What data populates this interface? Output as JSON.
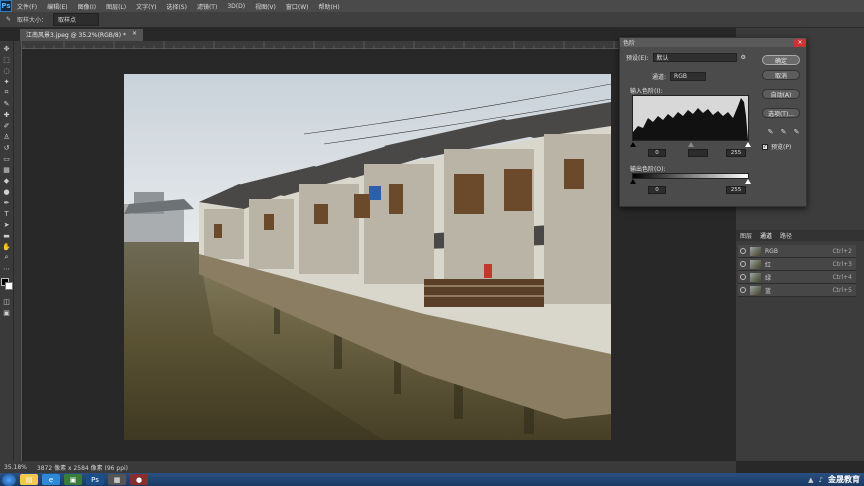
{
  "menubar": {
    "logo": "Ps",
    "items": [
      "文件(F)",
      "编辑(E)",
      "图像(I)",
      "图层(L)",
      "文字(Y)",
      "选择(S)",
      "滤镜(T)",
      "3D(D)",
      "视图(V)",
      "窗口(W)",
      "帮助(H)"
    ]
  },
  "options": {
    "sample_size_label": "取样大小：",
    "sample_size_value": "取样点"
  },
  "document": {
    "tab_title": "江南风景3.jpeg @ 35.2%(RGB/8) *",
    "close": "×"
  },
  "status": {
    "zoom": "35.18%",
    "info": "3872 像素 x 2584 像素 (96 ppi)"
  },
  "levels_dialog": {
    "title": "色阶",
    "preset_label": "预设(E):",
    "preset_value": "默认",
    "channel_label": "通道:",
    "channel_value": "RGB",
    "input_label": "输入色阶(I):",
    "input_black": "0",
    "input_gray": "1.00",
    "input_white": "255",
    "output_label": "输出色阶(O):",
    "output_black": "0",
    "output_white": "255",
    "btn_ok": "确定",
    "btn_cancel": "取消",
    "btn_auto": "自动(A)",
    "btn_options": "选项(T)...",
    "preview_label": "预览(P)",
    "preview_checked": true,
    "close": "×"
  },
  "channels_panel": {
    "tabs": [
      "图层",
      "通道",
      "路径"
    ],
    "rows": [
      {
        "name": "RGB",
        "key": "Ctrl+2"
      },
      {
        "name": "红",
        "key": "Ctrl+3"
      },
      {
        "name": "绿",
        "key": "Ctrl+4"
      },
      {
        "name": "蓝",
        "key": "Ctrl+5"
      }
    ]
  },
  "taskbar": {
    "brand": "金晟教育"
  },
  "colors": {
    "menubar": "#4a4a4a",
    "panel": "#3c3c3c",
    "canvas": "#282828",
    "dialog": "#4b4b4b",
    "taskbar": "#1f4271"
  }
}
